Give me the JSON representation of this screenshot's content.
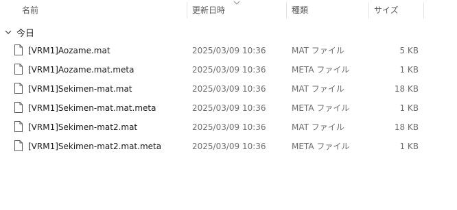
{
  "columns": {
    "name": "名前",
    "date": "更新日時",
    "type": "種類",
    "size": "サイズ"
  },
  "sort": {
    "column": "date",
    "direction": "descending"
  },
  "group": {
    "label": "今日",
    "expanded": true
  },
  "files": [
    {
      "name": "[VRM1]Aozame.mat",
      "date": "2025/03/09 10:36",
      "type": "MAT ファイル",
      "size": "5 KB"
    },
    {
      "name": "[VRM1]Aozame.mat.meta",
      "date": "2025/03/09 10:36",
      "type": "META ファイル",
      "size": "1 KB"
    },
    {
      "name": "[VRM1]Sekimen-mat.mat",
      "date": "2025/03/09 10:36",
      "type": "MAT ファイル",
      "size": "18 KB"
    },
    {
      "name": "[VRM1]Sekimen-mat.mat.meta",
      "date": "2025/03/09 10:36",
      "type": "META ファイル",
      "size": "1 KB"
    },
    {
      "name": "[VRM1]Sekimen-mat2.mat",
      "date": "2025/03/09 10:36",
      "type": "MAT ファイル",
      "size": "18 KB"
    },
    {
      "name": "[VRM1]Sekimen-mat2.mat.meta",
      "date": "2025/03/09 10:36",
      "type": "META ファイル",
      "size": "1 KB"
    }
  ],
  "icons": {
    "file": "file-icon",
    "group_toggle": "chevron-down-icon",
    "sort": "sort-descending-icon"
  },
  "colors": {
    "header_text": "#5a5a5a",
    "secondary_text": "#6d6d6d",
    "separator": "#e3e3e3"
  }
}
